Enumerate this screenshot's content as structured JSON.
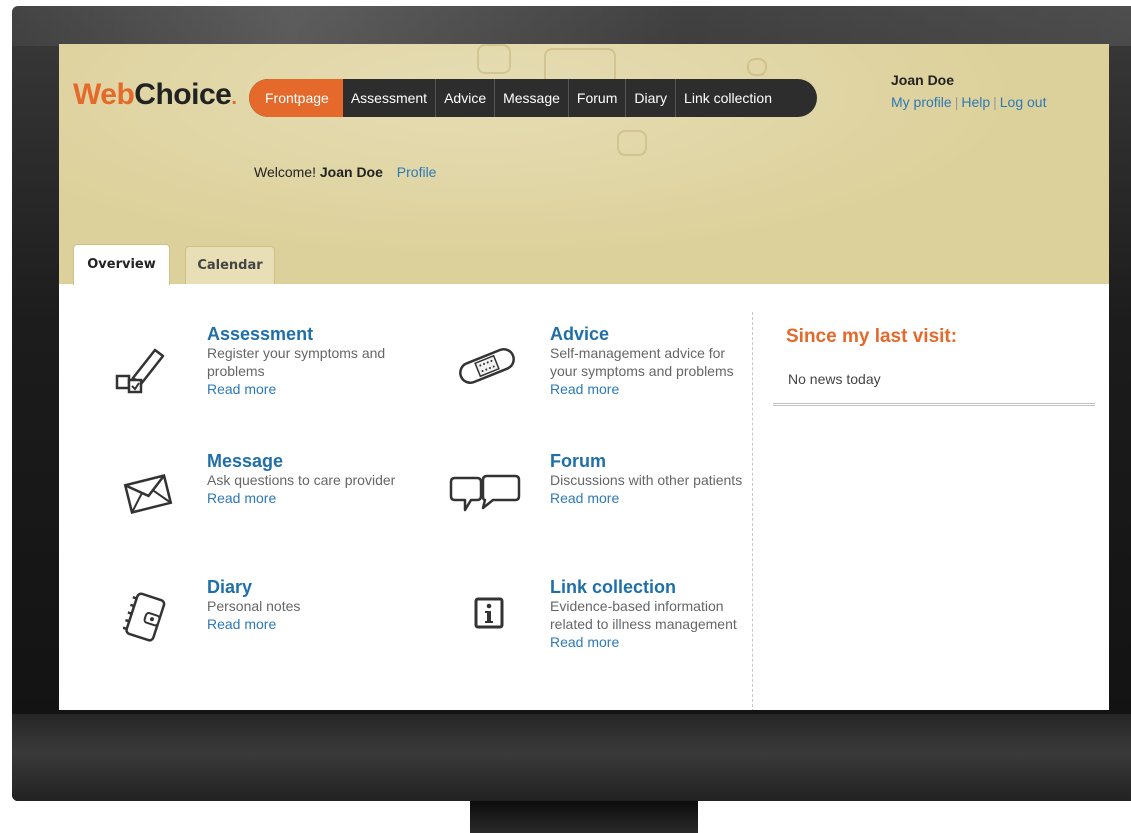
{
  "app": {
    "logo_web": "Web",
    "logo_choice": "Choice",
    "logo_dot": "."
  },
  "nav": {
    "items": [
      "Frontpage",
      "Assessment",
      "Advice",
      "Message",
      "Forum",
      "Diary",
      "Link collection"
    ],
    "active": "Frontpage"
  },
  "user": {
    "name": "Joan Doe",
    "my_profile": "My profile",
    "help": "Help",
    "logout": "Log out",
    "separator": "|"
  },
  "welcome": {
    "prefix": "Welcome!",
    "name": "Joan Doe",
    "profile_link": "Profile"
  },
  "tabs": [
    "Overview",
    "Calendar"
  ],
  "features": [
    {
      "title": "Assessment",
      "desc": "Register your symptoms and problems",
      "link": "Read more",
      "icon": "assessment-pen-icon"
    },
    {
      "title": "Advice",
      "desc": "Self-management advice for your symptoms and problems",
      "link": "Read more",
      "icon": "bandage-icon"
    },
    {
      "title": "Message",
      "desc": "Ask questions to care provider",
      "link": "Read more",
      "icon": "envelope-icon"
    },
    {
      "title": "Forum",
      "desc": "Discussions with other patients",
      "link": "Read more",
      "icon": "speech-bubbles-icon"
    },
    {
      "title": "Diary",
      "desc": "Personal notes",
      "link": "Read more",
      "icon": "diary-icon"
    },
    {
      "title": "Link collection",
      "desc": "Evidence-based information related to illness management",
      "link": "Read more",
      "icon": "info-icon"
    }
  ],
  "sidebar": {
    "title": "Since my last visit:",
    "news": "No news today"
  },
  "colors": {
    "accent": "#e4692a",
    "header_bg": "#ddd19b",
    "nav_bg": "#2d2d2d",
    "link": "#2d79b8",
    "title_blue": "#1f6fa8"
  }
}
